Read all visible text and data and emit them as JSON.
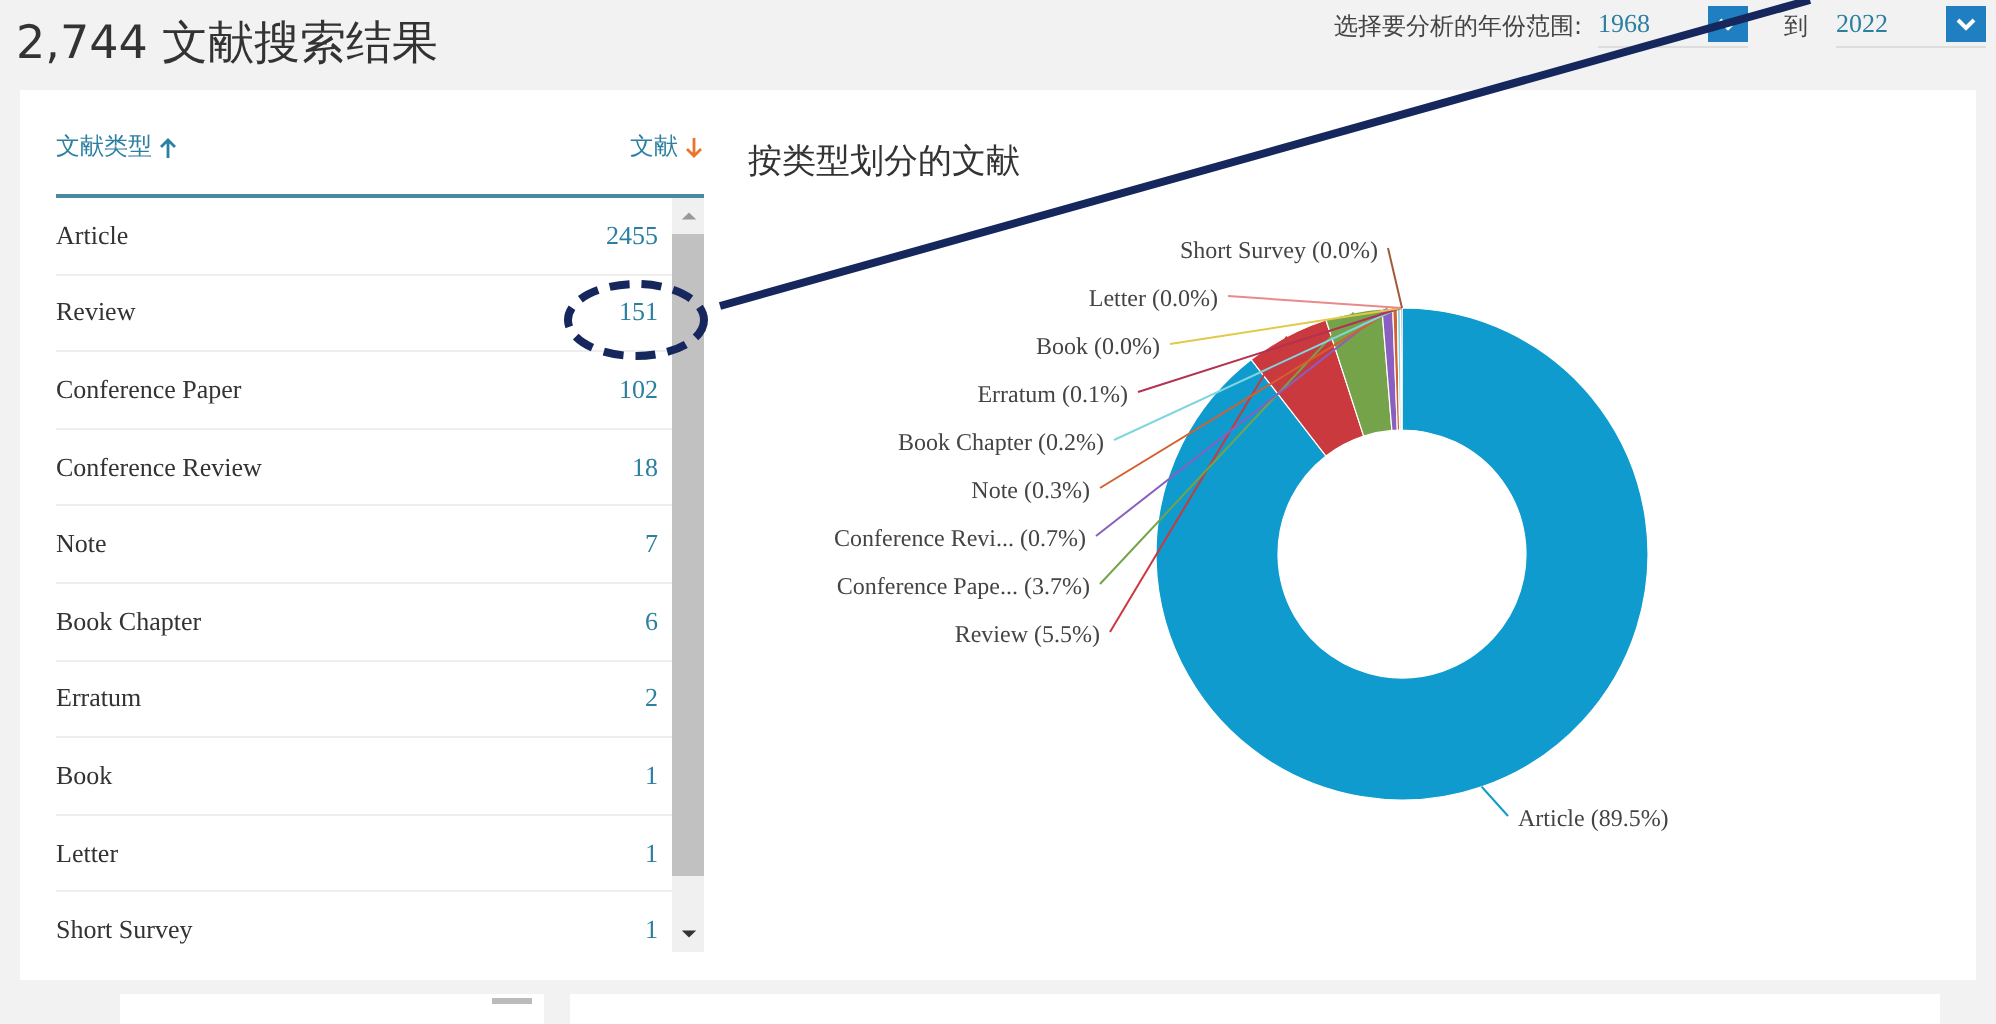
{
  "header": {
    "title": "2,744 文献搜索结果",
    "year_range": {
      "label": "选择要分析的年份范围:",
      "from": "1968",
      "separator": "到",
      "to": "2022"
    }
  },
  "table": {
    "columns": [
      {
        "label": "文献类型",
        "sort_ascending": true
      },
      {
        "label": "文献",
        "sort_ascending": false
      }
    ],
    "rows": [
      {
        "type": "Article",
        "count": "2455"
      },
      {
        "type": "Review",
        "count": "151"
      },
      {
        "type": "Conference Paper",
        "count": "102"
      },
      {
        "type": "Conference Review",
        "count": "18"
      },
      {
        "type": "Note",
        "count": "7"
      },
      {
        "type": "Book Chapter",
        "count": "6"
      },
      {
        "type": "Erratum",
        "count": "2"
      },
      {
        "type": "Book",
        "count": "1"
      },
      {
        "type": "Letter",
        "count": "1"
      },
      {
        "type": "Short Survey",
        "count": "1"
      }
    ]
  },
  "chart": {
    "title": "按类型划分的文献",
    "chart_data": {
      "type": "donut",
      "categories": [
        "Article",
        "Review",
        "Conference Pape...",
        "Conference Revi...",
        "Note",
        "Book Chapter",
        "Erratum",
        "Book",
        "Letter",
        "Short Survey"
      ],
      "values": [
        89.5,
        5.5,
        3.7,
        0.7,
        0.3,
        0.2,
        0.1,
        0.0,
        0.0,
        0.0
      ],
      "value_labels": [
        "(89.5%)",
        "(5.5%)",
        "(3.7%)",
        "(0.7%)",
        "(0.3%)",
        "(0.2%)",
        "(0.1%)",
        "(0.0%)",
        "(0.0%)",
        "(0.0%)"
      ]
    }
  }
}
